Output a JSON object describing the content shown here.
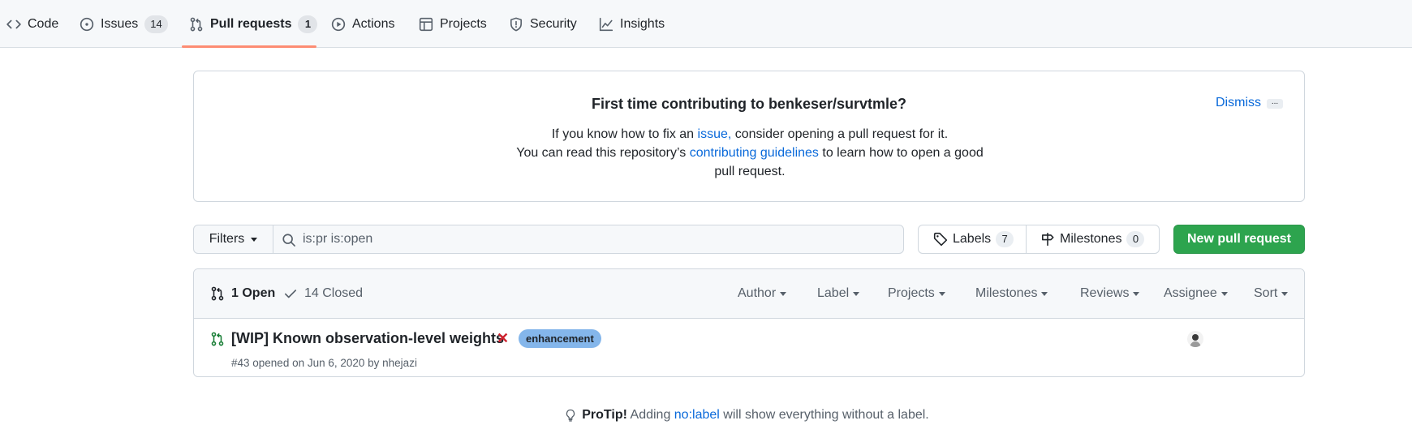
{
  "nav": {
    "tabs": [
      {
        "label": "Code",
        "icon": "code-icon"
      },
      {
        "label": "Issues",
        "icon": "issue-opened-icon",
        "counter": "14"
      },
      {
        "label": "Pull requests",
        "icon": "git-pull-request-icon",
        "counter": "1",
        "selected": true
      },
      {
        "label": "Actions",
        "icon": "play-icon"
      },
      {
        "label": "Projects",
        "icon": "table-icon"
      },
      {
        "label": "Security",
        "icon": "shield-icon"
      },
      {
        "label": "Insights",
        "icon": "graph-icon"
      }
    ],
    "accent_underline": "#fd8c73"
  },
  "contrib": {
    "title": "First time contributing to benkeser/survtmle?",
    "line1_pre": "If you know how to fix an ",
    "line1_link": "issue,",
    "line1_post": " consider opening a pull request for it.",
    "line2_pre": "You can read this repository’s ",
    "line2_link": "contributing guidelines",
    "line2_post": " to learn how to open a good pull request.",
    "dismiss": "Dismiss",
    "more": "..."
  },
  "filters": {
    "label": "Filters",
    "search_value": "is:pr is:open"
  },
  "labels": {
    "label": "Labels",
    "count": "7"
  },
  "milestones": {
    "label": "Milestones",
    "count": "0"
  },
  "new_pr": {
    "label": "New pull request",
    "color": "#2da44e"
  },
  "list": {
    "open_label": "1 Open",
    "closed_label": "14 Closed",
    "selects": [
      "Author",
      "Label",
      "Projects",
      "Milestones",
      "Reviews",
      "Assignee",
      "Sort"
    ],
    "rows": [
      {
        "title": "[WIP] Known observation-level weights",
        "status_mark": "✕",
        "label": "enhancement",
        "label_color": "#84b6eb",
        "meta": "#43 opened on Jun 6, 2020 by nhejazi"
      }
    ]
  },
  "protip": {
    "strong": "ProTip!",
    "pre": " Adding ",
    "link": "no:label",
    "post": " will show everything without a label."
  }
}
